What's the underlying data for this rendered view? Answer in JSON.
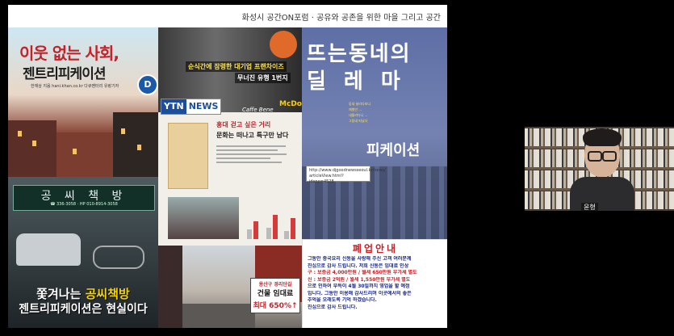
{
  "slide": {
    "title": "화성시 공간ON포럼 · 공유와 공존을 위한 마을 그리고 공간"
  },
  "book_cover": {
    "title": "이웃 없는 사회,",
    "subtitle": "젠트리피케이션",
    "author": "한재상 지음  hani.khan.co.kr 다큐멘터리 유랑기자",
    "badge": "D"
  },
  "bookstore": {
    "sign_name": "공 씨 책 방",
    "sign_phone": "☎ 336-3058 · HP 010-8914-3058",
    "headline_part1": "쫓겨나는 ",
    "headline_highlight": "공씨책방",
    "headline2": "젠트리피케이션은 현실이다"
  },
  "news": {
    "headline1": "순식간에 잠령한 대기업 프랜차이즈",
    "headline2": "무너진 유행 1번지",
    "logo_ytn": "YTN",
    "logo_news": "NEWS",
    "cafe_sign": "Caffe Bene",
    "mc_sign": "McDon",
    "article_title": "홍대 걷고 싶은 거리",
    "article_subtitle": "문화는 떠나고 특구만 남다"
  },
  "street": {
    "sign_line1": "용산구 경리단길",
    "sign_line2": "건물 임대료",
    "sign_line3": "최대 650%↑"
  },
  "dilemma": {
    "line1": "뜨는동네의",
    "line2": "딜레마",
    "small1": "동네 살리다보니",
    "small2": "재벌만 ...",
    "small3": "내몰리다니 ...",
    "small4": "그동네 떠났다",
    "word": "피케이션"
  },
  "tooltip": {
    "line1": "http://www.djgoodnewsseoul.kr/news/",
    "line2": "articleView.html?idxno=4528"
  },
  "notice": {
    "title": "폐업안내",
    "lines": [
      "그동안 중국요리 신동을 사랑해 주신 고객 여러분께",
      "진심으로 감사 드립니다. 저희 신동은 임대료 인상",
      "구 : 보증금 4,000만원 / 월세 650만원 부가세 별도",
      "신 : 보증금 2억원 / 월세 1,550만원 부가세 별도",
      "으로 인하여 부득이 4월 30일까지 영업을 할 예정",
      "입니다. 그동안 이용해 감사드리며 이곳에서의 좋은",
      "추억을 오래도록 기억 하겠습니다.",
      "진심으로 감사 드립니다."
    ]
  },
  "video": {
    "name": "윤형"
  }
}
